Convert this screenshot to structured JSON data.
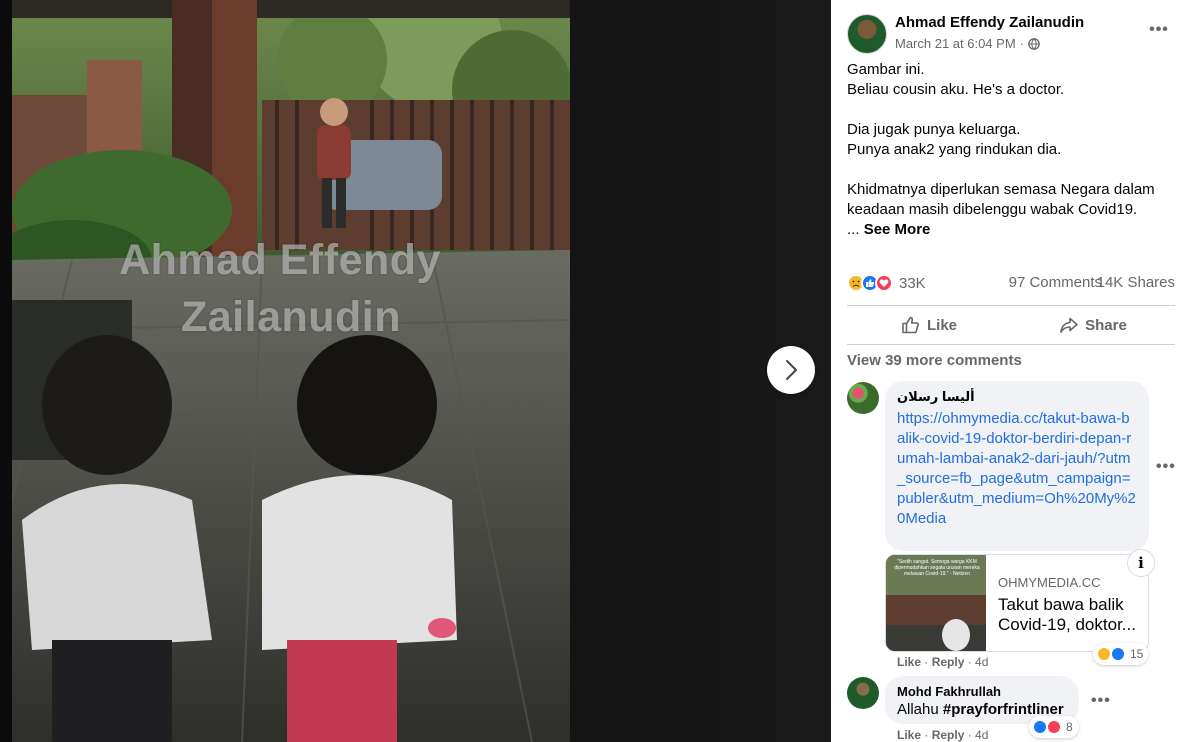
{
  "photo": {
    "watermark_line1": "Ahmad Effendy",
    "watermark_line2": "Zailanudin"
  },
  "theater": {
    "next_icon": "chevron-right-icon"
  },
  "post": {
    "author": "Ahmad Effendy Zailanudin",
    "timestamp": "March 21 at 6:04 PM",
    "separator": "·",
    "audience_icon": "globe-icon",
    "paragraphs": [
      "Gambar ini.\nBeliau cousin aku. He's a doctor.",
      "Dia jugak punya keluarga.\nPunya anak2 yang rindukan dia.",
      "Khidmatnya diperlukan semasa Negara dalam\nkeadaan masih dibelenggu wabak Covid19."
    ],
    "ellipsis": "...",
    "see_more": "See More"
  },
  "stats": {
    "reaction_icons": [
      "sad-reaction-icon",
      "like-reaction-icon",
      "love-reaction-icon"
    ],
    "reaction_count": "33K",
    "comments": "97 Comments",
    "shares": "14K Shares"
  },
  "actions": {
    "like": "Like",
    "share": "Share"
  },
  "view_more_comments": "View 39 more comments",
  "comments": [
    {
      "name": "أليسا رسلان",
      "link": "https://ohmymedia.cc/takut-bawa-balik-covid-19-doktor-berdiri-depan-rumah-lambai-anak2-dari-jauh/?utm_source=fb_page&utm_campaign=publer&utm_medium=Oh%20My%20Media",
      "card": {
        "domain": "OHMYMEDIA.CC",
        "title_line1": "Takut bawa balik",
        "title_line2": "Covid-19, doktor...",
        "thumb_caption": "\"Sedih sangat. Semoga warga KKM dipermudahkan segala urusan mereka melawan Covid-19.\" - Netizen"
      },
      "reaction_count": "15",
      "like": "Like",
      "reply": "Reply",
      "age": "4d"
    },
    {
      "name": "Mohd Fakhrullah",
      "text_prefix": "Allahu ",
      "hashtag": "#prayforfrintliner",
      "reaction_count": "8",
      "like": "Like",
      "reply": "Reply",
      "age": "4d"
    }
  ],
  "colors": {
    "link": "#216fdb",
    "like_blue": "#1877f2",
    "love_red": "#f33e58",
    "sad_yellow": "#f7b928",
    "secondary_text": "#65676b"
  }
}
